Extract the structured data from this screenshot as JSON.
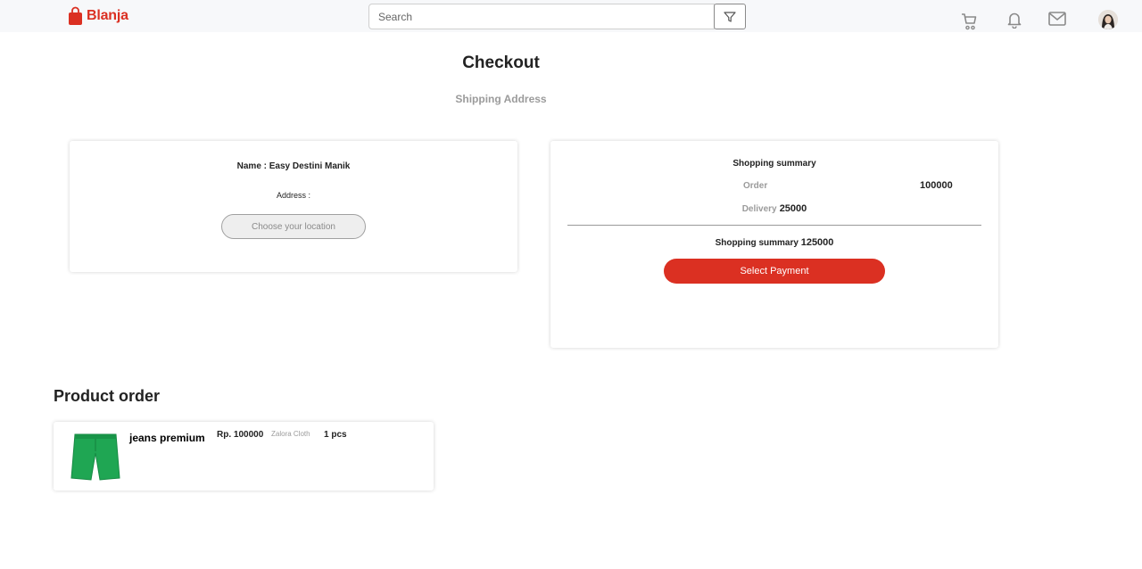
{
  "brand": {
    "name": "Blanja",
    "accent_color": "#db3022",
    "logo_icon": "shopping-bag-icon"
  },
  "search": {
    "placeholder": "Search",
    "value": ""
  },
  "nav_icons": [
    "filter-icon",
    "cart-icon",
    "bell-icon",
    "mail-icon",
    "avatar"
  ],
  "checkout": {
    "title": "Checkout",
    "subtitle": "Shipping Address"
  },
  "address": {
    "name_line": "Name : Easy Destini Manik",
    "address_label": "Address :",
    "location_button": "Choose your location"
  },
  "summary": {
    "title": "Shopping summary",
    "order_label": "Order",
    "order_value": "100000",
    "delivery_label": "Delivery",
    "delivery_value": "25000",
    "total_label": "Shopping summary",
    "total_value": "125000",
    "pay_button": "Select Payment"
  },
  "product_order": {
    "title": "Product order",
    "items": [
      {
        "name": "jeans premium",
        "price": "Rp. 100000",
        "store": "Zalora Cloth",
        "qty": "1 pcs",
        "image": "green-shorts-image"
      }
    ]
  }
}
